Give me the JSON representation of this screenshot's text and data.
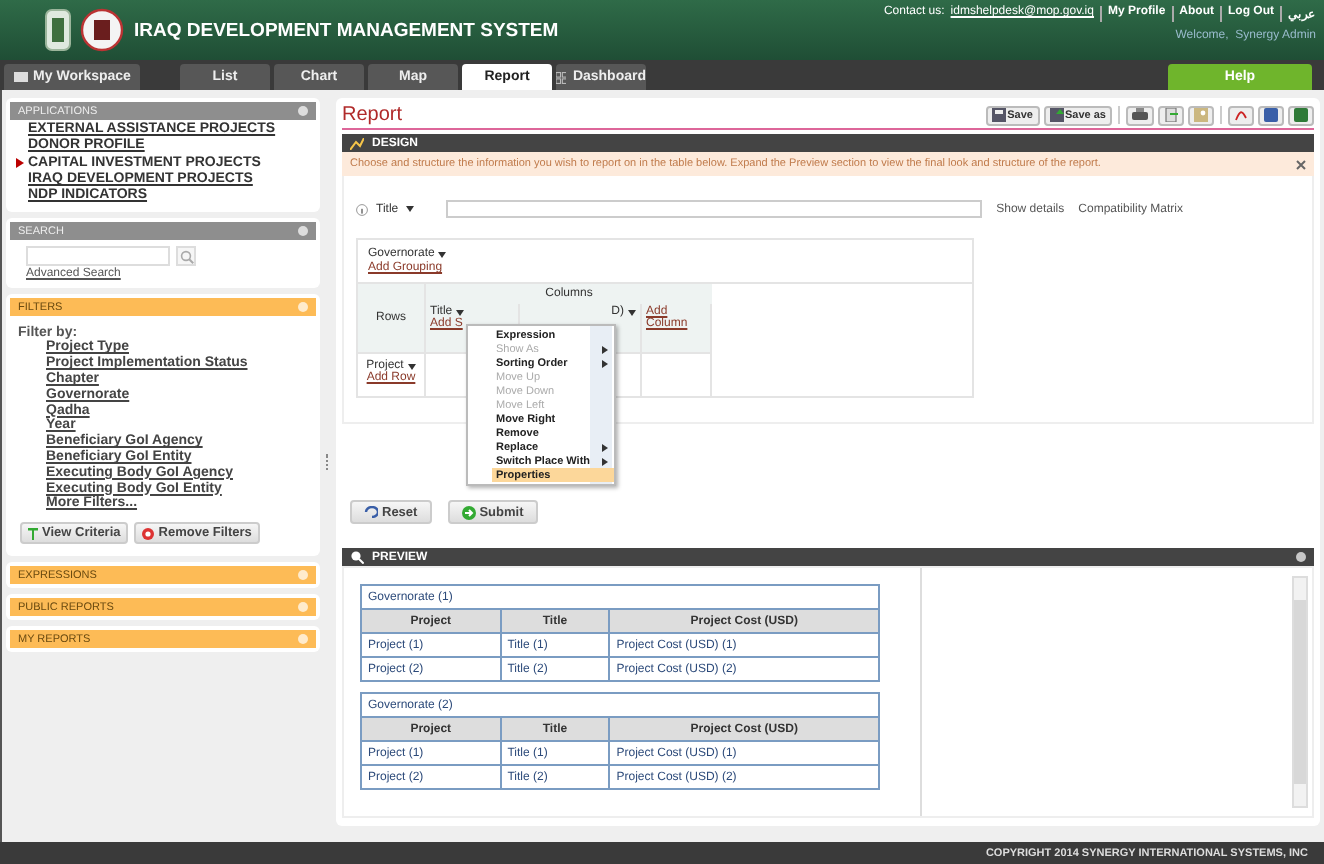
{
  "header": {
    "title": "IRAQ DEVELOPMENT MANAGEMENT SYSTEM",
    "contact_label": "Contact us:",
    "contact_email": "idmshelpdesk@mop.gov.iq",
    "links": [
      "My Profile",
      "About",
      "Log Out",
      "عربي"
    ],
    "welcome": "Welcome,  Synergy Admin"
  },
  "tabs": [
    {
      "label": "My Workspace",
      "selected": false,
      "kind": "workspace"
    },
    {
      "label": "List",
      "selected": false,
      "kind": "plain"
    },
    {
      "label": "Chart",
      "selected": false,
      "kind": "plain"
    },
    {
      "label": "Map",
      "selected": false,
      "kind": "plain"
    },
    {
      "label": "Report",
      "selected": true,
      "kind": "plain"
    },
    {
      "label": "Dashboard",
      "selected": false,
      "kind": "dashboard"
    }
  ],
  "help": "Help",
  "sidebar": {
    "applications": {
      "title": "APPLICATIONS",
      "items": [
        {
          "label": "EXTERNAL ASSISTANCE PROJECTS",
          "selected": false
        },
        {
          "label": "DONOR PROFILE",
          "selected": false
        },
        {
          "label": "CAPITAL INVESTMENT PROJECTS",
          "selected": true
        },
        {
          "label": "IRAQ DEVELOPMENT PROJECTS",
          "selected": false
        },
        {
          "label": "NDP INDICATORS",
          "selected": false
        }
      ]
    },
    "search": {
      "title": "SEARCH",
      "advanced": "Advanced Search"
    },
    "filters": {
      "title": "FILTERS",
      "filter_by": "Filter by:",
      "items": [
        "Project Type",
        "Project Implementation Status",
        "Chapter",
        "Governorate",
        "Qadha",
        "Year",
        "Beneficiary GoI Agency",
        "Beneficiary GoI Entity",
        "Executing Body GoI Agency",
        "Executing Body GoI Entity"
      ],
      "more": "More Filters...",
      "buttons": [
        "View Criteria",
        "Remove Filters"
      ]
    },
    "panels": [
      "EXPRESSIONS",
      "PUBLIC REPORTS",
      "MY REPORTS"
    ]
  },
  "report": {
    "title": "Report",
    "save": "Save",
    "save_as": "Save as"
  },
  "design": {
    "title": "DESIGN",
    "info": "Choose and structure the information you wish to report on in the table below. Expand the Preview section to view the final look and structure of the report.",
    "title_label": "Title",
    "show_details": "Show details",
    "compatibility": "Compatibility Matrix",
    "grouping": "Governorate",
    "add_grouping": "Add Grouping",
    "columns_label": "Columns",
    "rows_label": "Rows",
    "column_fields": [
      "Title",
      "D)"
    ],
    "add_sort": "Add S",
    "add_column": "Add Column",
    "row_field": "Project",
    "add_row": "Add Row"
  },
  "context_menu": [
    {
      "label": "Expression",
      "disabled": false,
      "submenu": false,
      "selected": false
    },
    {
      "label": "Show As",
      "disabled": true,
      "submenu": true,
      "selected": false
    },
    {
      "label": "Sorting Order",
      "disabled": false,
      "submenu": true,
      "selected": false
    },
    {
      "label": "Move Up",
      "disabled": true,
      "submenu": false,
      "selected": false
    },
    {
      "label": "Move Down",
      "disabled": true,
      "submenu": false,
      "selected": false
    },
    {
      "label": "Move Left",
      "disabled": true,
      "submenu": false,
      "selected": false
    },
    {
      "label": "Move Right",
      "disabled": false,
      "submenu": false,
      "selected": false
    },
    {
      "label": "Remove",
      "disabled": false,
      "submenu": false,
      "selected": false
    },
    {
      "label": "Replace",
      "disabled": false,
      "submenu": true,
      "selected": false
    },
    {
      "label": "Switch Place With",
      "disabled": false,
      "submenu": true,
      "selected": false
    },
    {
      "label": "Properties",
      "disabled": false,
      "submenu": false,
      "selected": true
    }
  ],
  "actions": [
    "Reset",
    "Submit"
  ],
  "preview": {
    "title": "PREVIEW",
    "groups": [
      {
        "title": "Governorate (1)",
        "columns": [
          "Project",
          "Title",
          "Project Cost (USD)"
        ],
        "rows": [
          [
            "Project (1)",
            "Title (1)",
            "Project Cost (USD) (1)"
          ],
          [
            "Project (2)",
            "Title (2)",
            "Project Cost (USD) (2)"
          ]
        ]
      },
      {
        "title": "Governorate (2)",
        "columns": [
          "Project",
          "Title",
          "Project Cost (USD)"
        ],
        "rows": [
          [
            "Project (1)",
            "Title (1)",
            "Project Cost (USD) (1)"
          ],
          [
            "Project (2)",
            "Title (2)",
            "Project Cost (USD) (2)"
          ]
        ]
      }
    ]
  },
  "footer": "COPYRIGHT 2014 SYNERGY INTERNATIONAL SYSTEMS, INC"
}
